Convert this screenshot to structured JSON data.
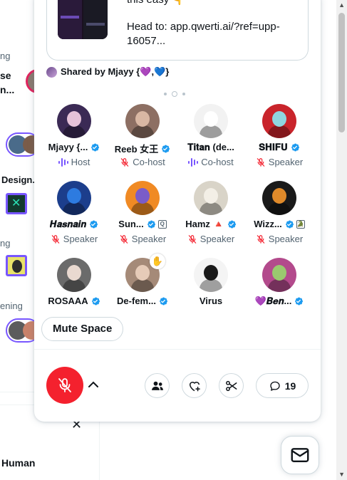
{
  "background": {
    "label_1": "ng",
    "label_2a": "se",
    "label_2b": "n...",
    "design_label": "Design..",
    "label_3": "ng",
    "label_4": "ening",
    "bottom_name": "Human",
    "close_glyph": "✕"
  },
  "card": {
    "line1": "this easy 👇",
    "line2": "Head to: app.qwerti.ai/?ref=upp-",
    "line3": "16057..."
  },
  "shared_by": "Shared by Mjayy {💜,💙}",
  "members": [
    {
      "name": "Mjayy {...",
      "verified": true,
      "role": "Host",
      "role_icon": "host-bars-icon",
      "avatar_color": "#3b2a55",
      "face_color": "#e6c3d9"
    },
    {
      "name": "Reeb 女王",
      "verified": true,
      "role": "Co-host",
      "role_icon": "mic-off-icon",
      "avatar_color": "#8d6f63",
      "face_color": "#d9b7a3"
    },
    {
      "name": "𝐓𝐢𝐭𝐚𝐧 (de...",
      "verified": false,
      "role": "Co-host",
      "role_icon": "host-bars-icon",
      "avatar_color": "#f2f2f2",
      "face_color": "#ffffff"
    },
    {
      "name": "𝐒𝐇𝐈𝐅𝐔",
      "verified": true,
      "role": "Speaker",
      "role_icon": "mic-off-icon",
      "avatar_color": "#c9242b",
      "face_color": "#8fd6e0"
    },
    {
      "name": "𝑯𝒂𝒔𝒏𝒂𝒊𝒏",
      "verified": true,
      "role": "Speaker",
      "role_icon": "mic-off-icon",
      "avatar_color": "#1c3e8c",
      "face_color": "#2d7be0"
    },
    {
      "name": "Sun...",
      "verified": true,
      "extra_badge": "Q",
      "role": "Speaker",
      "role_icon": "mic-off-icon",
      "avatar_color": "#f08a24",
      "face_color": "#7a5cc9"
    },
    {
      "name": "Hamz 🔺",
      "verified": true,
      "role": "Speaker",
      "role_icon": "mic-off-icon",
      "avatar_color": "#d9d4c8",
      "face_color": "#f3efe6"
    },
    {
      "name": "Wizz...",
      "verified": true,
      "extra_badge": "🐊",
      "role": "Speaker",
      "role_icon": "mic-off-icon",
      "avatar_color": "#1a1a1a",
      "face_color": "#e08a2a"
    },
    {
      "name": "ROSAAA",
      "verified": true,
      "role": "",
      "avatar_color": "#6b6b6b",
      "face_color": "#e9d9d0"
    },
    {
      "name": "De-fem...",
      "verified": true,
      "role": "",
      "hand": "✋",
      "avatar_color": "#a58a78",
      "face_color": "#e6cbb8"
    },
    {
      "name": "Virus",
      "verified": false,
      "role": "",
      "avatar_color": "#f4f4f4",
      "face_color": "#1a1a1a"
    },
    {
      "name": "💜𝑩𝒆𝒏...",
      "verified": true,
      "role": "",
      "avatar_color": "#b34a8c",
      "face_color": "#9ac96f"
    }
  ],
  "mute_space_label": "Mute Space",
  "comments_count": "19",
  "colors": {
    "accent": "#1d9bf0",
    "record_red": "#f4212e",
    "host_purple": "#7856ff",
    "speaker_red": "#f4212e"
  }
}
